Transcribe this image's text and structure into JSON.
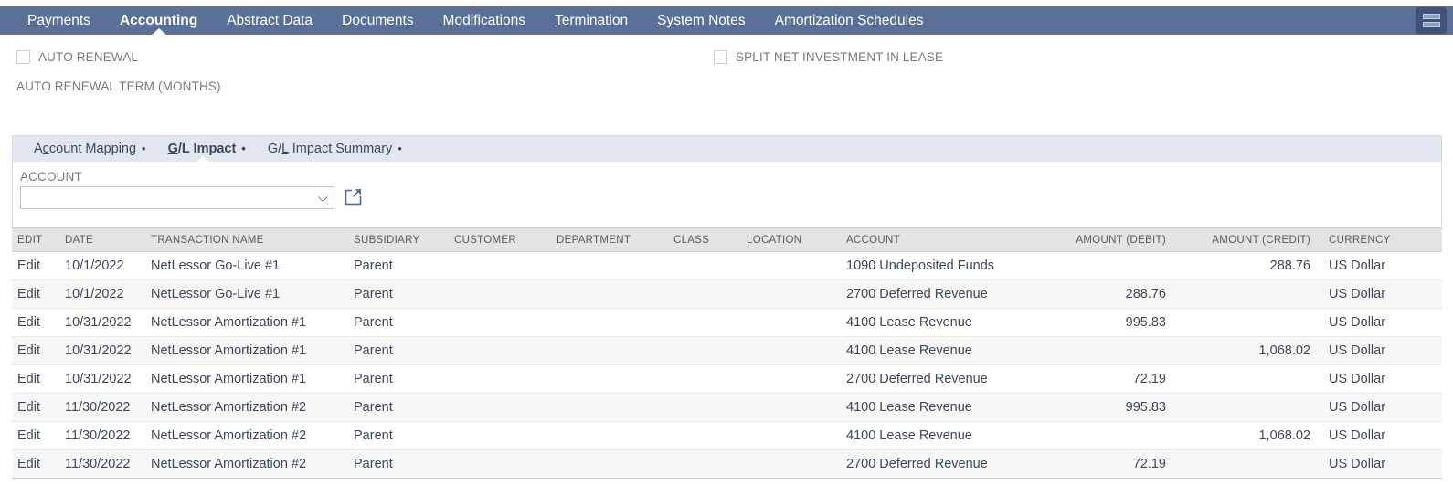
{
  "topnav": {
    "tabs": [
      {
        "label": "Payments",
        "accel": "P",
        "active": false
      },
      {
        "label": "Accounting",
        "accel": "A",
        "active": true
      },
      {
        "label": "Abstract Data",
        "accel": "b",
        "active": false
      },
      {
        "label": "Documents",
        "accel": "D",
        "active": false
      },
      {
        "label": "Modifications",
        "accel": "M",
        "active": false
      },
      {
        "label": "Termination",
        "accel": "T",
        "active": false
      },
      {
        "label": "System Notes",
        "accel": "S",
        "active": false
      },
      {
        "label": "Amortization Schedules",
        "accel": "o",
        "active": false
      }
    ],
    "menu_button": "menu-icon",
    "bar_color": "#5b7099",
    "menu_button_color": "#3f527a"
  },
  "options": {
    "auto_renewal": {
      "label": "AUTO RENEWAL",
      "checked": false
    },
    "split_net_investment": {
      "label": "SPLIT NET INVESTMENT IN LEASE",
      "checked": false
    },
    "auto_renewal_term_label": "AUTO RENEWAL TERM (MONTHS)"
  },
  "subtabs": [
    {
      "label": "Account Mapping",
      "accel": "c",
      "bullet": "•",
      "active": false
    },
    {
      "label": "G/L Impact",
      "accel": "G",
      "bullet": "•",
      "active": true
    },
    {
      "label": "G/L Impact Summary",
      "accel": "L",
      "bullet": "•",
      "active": false
    }
  ],
  "account_filter": {
    "label": "ACCOUNT",
    "value": "",
    "placeholder": "",
    "dropdown_icon": "double-chevron-down-icon",
    "popup_icon": "external-link-icon"
  },
  "table": {
    "columns": [
      {
        "key": "edit",
        "label": "EDIT",
        "align": "left"
      },
      {
        "key": "date",
        "label": "DATE",
        "align": "left"
      },
      {
        "key": "transaction_name",
        "label": "TRANSACTION NAME",
        "align": "left"
      },
      {
        "key": "subsidiary",
        "label": "SUBSIDIARY",
        "align": "left"
      },
      {
        "key": "customer",
        "label": "CUSTOMER",
        "align": "left"
      },
      {
        "key": "department",
        "label": "DEPARTMENT",
        "align": "left"
      },
      {
        "key": "class",
        "label": "CLASS",
        "align": "left"
      },
      {
        "key": "location",
        "label": "LOCATION",
        "align": "left"
      },
      {
        "key": "account",
        "label": "ACCOUNT",
        "align": "left"
      },
      {
        "key": "amount_debit",
        "label": "AMOUNT (DEBIT)",
        "align": "right"
      },
      {
        "key": "amount_credit",
        "label": "AMOUNT (CREDIT)",
        "align": "right"
      },
      {
        "key": "currency",
        "label": "CURRENCY",
        "align": "left"
      }
    ],
    "rows": [
      {
        "edit": "Edit",
        "date": "10/1/2022",
        "transaction_name": "NetLessor Go-Live #1",
        "subsidiary": "Parent",
        "customer": "",
        "department": "",
        "class": "",
        "location": "",
        "account": "1090 Undeposited Funds",
        "amount_debit": "",
        "amount_credit": "288.76",
        "currency": "US Dollar"
      },
      {
        "edit": "Edit",
        "date": "10/1/2022",
        "transaction_name": "NetLessor Go-Live #1",
        "subsidiary": "Parent",
        "customer": "",
        "department": "",
        "class": "",
        "location": "",
        "account": "2700 Deferred Revenue",
        "amount_debit": "288.76",
        "amount_credit": "",
        "currency": "US Dollar"
      },
      {
        "edit": "Edit",
        "date": "10/31/2022",
        "transaction_name": "NetLessor Amortization #1",
        "subsidiary": "Parent",
        "customer": "",
        "department": "",
        "class": "",
        "location": "",
        "account": "4100 Lease Revenue",
        "amount_debit": "995.83",
        "amount_credit": "",
        "currency": "US Dollar"
      },
      {
        "edit": "Edit",
        "date": "10/31/2022",
        "transaction_name": "NetLessor Amortization #1",
        "subsidiary": "Parent",
        "customer": "",
        "department": "",
        "class": "",
        "location": "",
        "account": "4100 Lease Revenue",
        "amount_debit": "",
        "amount_credit": "1,068.02",
        "currency": "US Dollar"
      },
      {
        "edit": "Edit",
        "date": "10/31/2022",
        "transaction_name": "NetLessor Amortization #1",
        "subsidiary": "Parent",
        "customer": "",
        "department": "",
        "class": "",
        "location": "",
        "account": "2700 Deferred Revenue",
        "amount_debit": "72.19",
        "amount_credit": "",
        "currency": "US Dollar"
      },
      {
        "edit": "Edit",
        "date": "11/30/2022",
        "transaction_name": "NetLessor Amortization #2",
        "subsidiary": "Parent",
        "customer": "",
        "department": "",
        "class": "",
        "location": "",
        "account": "4100 Lease Revenue",
        "amount_debit": "995.83",
        "amount_credit": "",
        "currency": "US Dollar"
      },
      {
        "edit": "Edit",
        "date": "11/30/2022",
        "transaction_name": "NetLessor Amortization #2",
        "subsidiary": "Parent",
        "customer": "",
        "department": "",
        "class": "",
        "location": "",
        "account": "4100 Lease Revenue",
        "amount_debit": "",
        "amount_credit": "1,068.02",
        "currency": "US Dollar"
      },
      {
        "edit": "Edit",
        "date": "11/30/2022",
        "transaction_name": "NetLessor Amortization #2",
        "subsidiary": "Parent",
        "customer": "",
        "department": "",
        "class": "",
        "location": "",
        "account": "2700 Deferred Revenue",
        "amount_debit": "72.19",
        "amount_credit": "",
        "currency": "US Dollar"
      }
    ]
  },
  "colors": {
    "nav_bg": "#5b7099",
    "subtab_bg": "#e2e7ef",
    "link": "#4f6d9e",
    "header_bg": "#e4e4e4"
  }
}
